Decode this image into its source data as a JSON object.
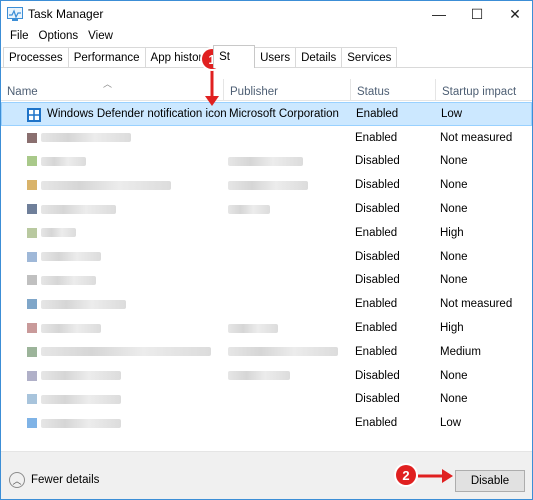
{
  "window": {
    "title": "Task Manager",
    "controls": {
      "minimize": "—",
      "maximize": "☐",
      "close": "✕"
    }
  },
  "menu": [
    "File",
    "Options",
    "View"
  ],
  "tabs": [
    "Processes",
    "Performance",
    "App history",
    "St",
    "Users",
    "Details",
    "Services"
  ],
  "active_tab_index": 3,
  "columns": {
    "name": "Name",
    "publisher": "Publisher",
    "status": "Status",
    "impact": "Startup impact"
  },
  "rows": [
    {
      "name": "Windows Defender notification icon",
      "publisher": "Microsoft Corporation",
      "status": "Enabled",
      "impact": "Low",
      "selected": true,
      "nameBlur": 0,
      "pubBlur": 0
    },
    {
      "name": "",
      "publisher": "",
      "status": "Enabled",
      "impact": "Not measured",
      "nameBlur": 90,
      "pubBlur": 0
    },
    {
      "name": "",
      "publisher": "",
      "status": "Disabled",
      "impact": "None",
      "nameBlur": 45,
      "pubBlur": 75
    },
    {
      "name": "",
      "publisher": "",
      "status": "Disabled",
      "impact": "None",
      "nameBlur": 130,
      "pubBlur": 80
    },
    {
      "name": "",
      "publisher": "",
      "status": "Disabled",
      "impact": "None",
      "nameBlur": 75,
      "pubBlur": 42
    },
    {
      "name": "",
      "publisher": "",
      "status": "Enabled",
      "impact": "High",
      "nameBlur": 35,
      "pubBlur": 0
    },
    {
      "name": "",
      "publisher": "",
      "status": "Disabled",
      "impact": "None",
      "nameBlur": 60,
      "pubBlur": 0
    },
    {
      "name": "",
      "publisher": "",
      "status": "Disabled",
      "impact": "None",
      "nameBlur": 55,
      "pubBlur": 0
    },
    {
      "name": "",
      "publisher": "",
      "status": "Enabled",
      "impact": "Not measured",
      "nameBlur": 85,
      "pubBlur": 0
    },
    {
      "name": "",
      "publisher": "",
      "status": "Enabled",
      "impact": "High",
      "nameBlur": 60,
      "pubBlur": 50
    },
    {
      "name": "",
      "publisher": "",
      "status": "Enabled",
      "impact": "Medium",
      "nameBlur": 170,
      "pubBlur": 110
    },
    {
      "name": "",
      "publisher": "",
      "status": "Disabled",
      "impact": "None",
      "nameBlur": 80,
      "pubBlur": 62
    },
    {
      "name": "",
      "publisher": "",
      "status": "Disabled",
      "impact": "None",
      "nameBlur": 80,
      "pubBlur": 0
    },
    {
      "name": "",
      "publisher": "",
      "status": "Enabled",
      "impact": "Low",
      "nameBlur": 80,
      "pubBlur": 0
    }
  ],
  "footer": {
    "fewer_details": "Fewer details",
    "disable": "Disable"
  },
  "callouts": [
    "1",
    "2"
  ],
  "colors": {
    "accent": "#3c8ed6",
    "selection": "#cce8ff",
    "callout": "#e02020"
  }
}
